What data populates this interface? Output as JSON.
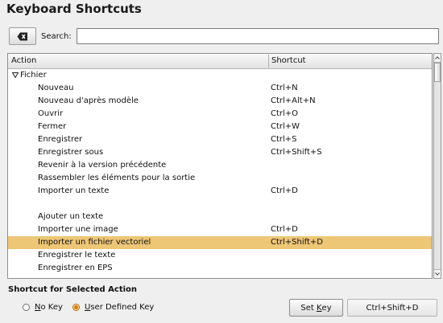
{
  "window": {
    "title": "Keyboard Shortcuts"
  },
  "search": {
    "label": "Search:",
    "value": "",
    "clear_icon": "clear-input-icon"
  },
  "table": {
    "columns": [
      "Action",
      "Shortcut"
    ],
    "group": {
      "label": "Fichier",
      "expanded": true
    },
    "rows": [
      {
        "action": "Nouveau",
        "shortcut": "Ctrl+N"
      },
      {
        "action": "Nouveau d'après modèle",
        "shortcut": "Ctrl+Alt+N"
      },
      {
        "action": "Ouvrir",
        "shortcut": "Ctrl+O"
      },
      {
        "action": "Fermer",
        "shortcut": "Ctrl+W"
      },
      {
        "action": "Enregistrer",
        "shortcut": "Ctrl+S"
      },
      {
        "action": "Enregistrer sous",
        "shortcut": "Ctrl+Shift+S"
      },
      {
        "action": "Revenir à la version précédente",
        "shortcut": ""
      },
      {
        "action": "Rassembler les éléments pour la sortie",
        "shortcut": ""
      },
      {
        "action": "Importer un texte",
        "shortcut": "Ctrl+D"
      },
      {
        "action": "",
        "shortcut": ""
      },
      {
        "action": "Ajouter un texte",
        "shortcut": ""
      },
      {
        "action": "Importer une image",
        "shortcut": "Ctrl+D"
      },
      {
        "action": "Importer un fichier vectoriel",
        "shortcut": "Ctrl+Shift+D",
        "selected": true
      },
      {
        "action": "Enregistrer le texte",
        "shortcut": ""
      },
      {
        "action": "Enregistrer en EPS",
        "shortcut": ""
      }
    ],
    "selection_color": "#edc676"
  },
  "shortcut_section": {
    "title": "Shortcut for Selected Action",
    "no_key": {
      "label_underlined": "N",
      "label_rest": "o Key",
      "checked": false
    },
    "user_key": {
      "label_underlined": "U",
      "label_rest": "ser Defined Key",
      "checked": true
    },
    "set_key": {
      "label_before": "Set ",
      "label_underlined": "K",
      "label_after": "ey"
    },
    "current_key": "Ctrl+Shift+D"
  }
}
